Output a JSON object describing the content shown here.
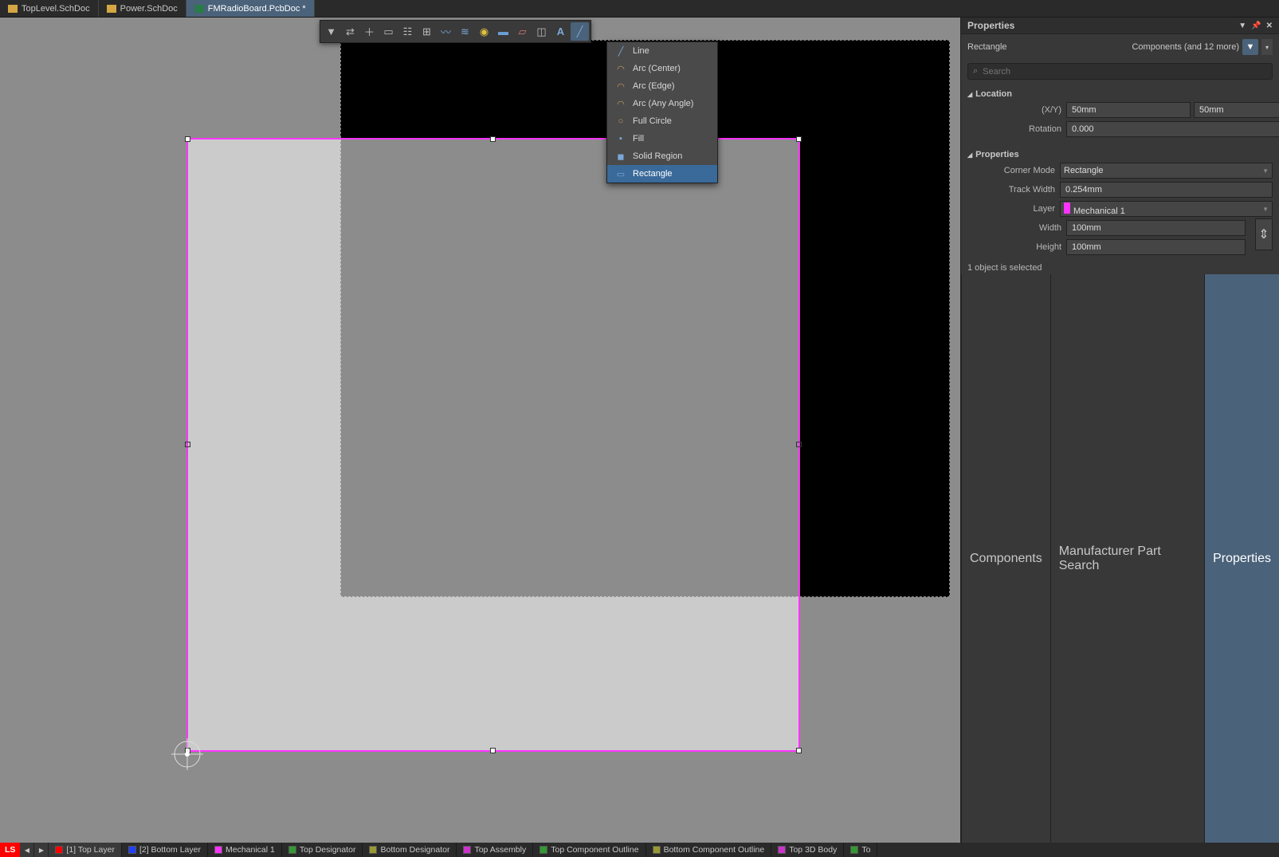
{
  "tabs": [
    {
      "label": "TopLevel.SchDoc",
      "type": "sch",
      "active": false
    },
    {
      "label": "Power.SchDoc",
      "type": "sch",
      "active": false
    },
    {
      "label": "FMRadioBoard.PcbDoc *",
      "type": "pcb",
      "active": true
    }
  ],
  "dropdown": {
    "items": [
      {
        "label": "Line",
        "icon": "line"
      },
      {
        "label": "Arc (Center)",
        "icon": "arc"
      },
      {
        "label": "Arc (Edge)",
        "icon": "arc"
      },
      {
        "label": "Arc (Any Angle)",
        "icon": "arc"
      },
      {
        "label": "Full Circle",
        "icon": "circle"
      },
      {
        "label": "Fill",
        "icon": "fill"
      },
      {
        "label": "Solid Region",
        "icon": "region"
      },
      {
        "label": "Rectangle",
        "icon": "rect",
        "selected": true
      }
    ]
  },
  "properties": {
    "panel_title": "Properties",
    "object_type": "Rectangle",
    "filter_summary": "Components (and 12 more)",
    "search_placeholder": "Search",
    "sections": {
      "location": {
        "title": "Location",
        "xy_label": "(X/Y)",
        "x": "50mm",
        "y": "50mm",
        "rotation_label": "Rotation",
        "rotation": "0.000"
      },
      "props": {
        "title": "Properties",
        "corner_mode_label": "Corner Mode",
        "corner_mode": "Rectangle",
        "track_width_label": "Track Width",
        "track_width": "0.254mm",
        "layer_label": "Layer",
        "layer": "Mechanical 1",
        "layer_color": "#ff33ff",
        "width_label": "Width",
        "width": "100mm",
        "height_label": "Height",
        "height": "100mm"
      }
    },
    "status": "1 object is selected",
    "right_tabs": [
      "Components",
      "Manufacturer Part Search",
      "Properties"
    ]
  },
  "layers": [
    {
      "label": "[1] Top Layer",
      "color": "#ff0000",
      "active": true
    },
    {
      "label": "[2] Bottom Layer",
      "color": "#2040ff"
    },
    {
      "label": "Mechanical 1",
      "color": "#ff33ff"
    },
    {
      "label": "Top Designator",
      "color": "#339933"
    },
    {
      "label": "Bottom Designator",
      "color": "#999933"
    },
    {
      "label": "Top Assembly",
      "color": "#cc33cc"
    },
    {
      "label": "Top Component Outline",
      "color": "#339933"
    },
    {
      "label": "Bottom Component Outline",
      "color": "#999933"
    },
    {
      "label": "Top 3D Body",
      "color": "#cc33cc"
    },
    {
      "label": "To",
      "color": "#339933"
    }
  ],
  "ls_label": "LS"
}
